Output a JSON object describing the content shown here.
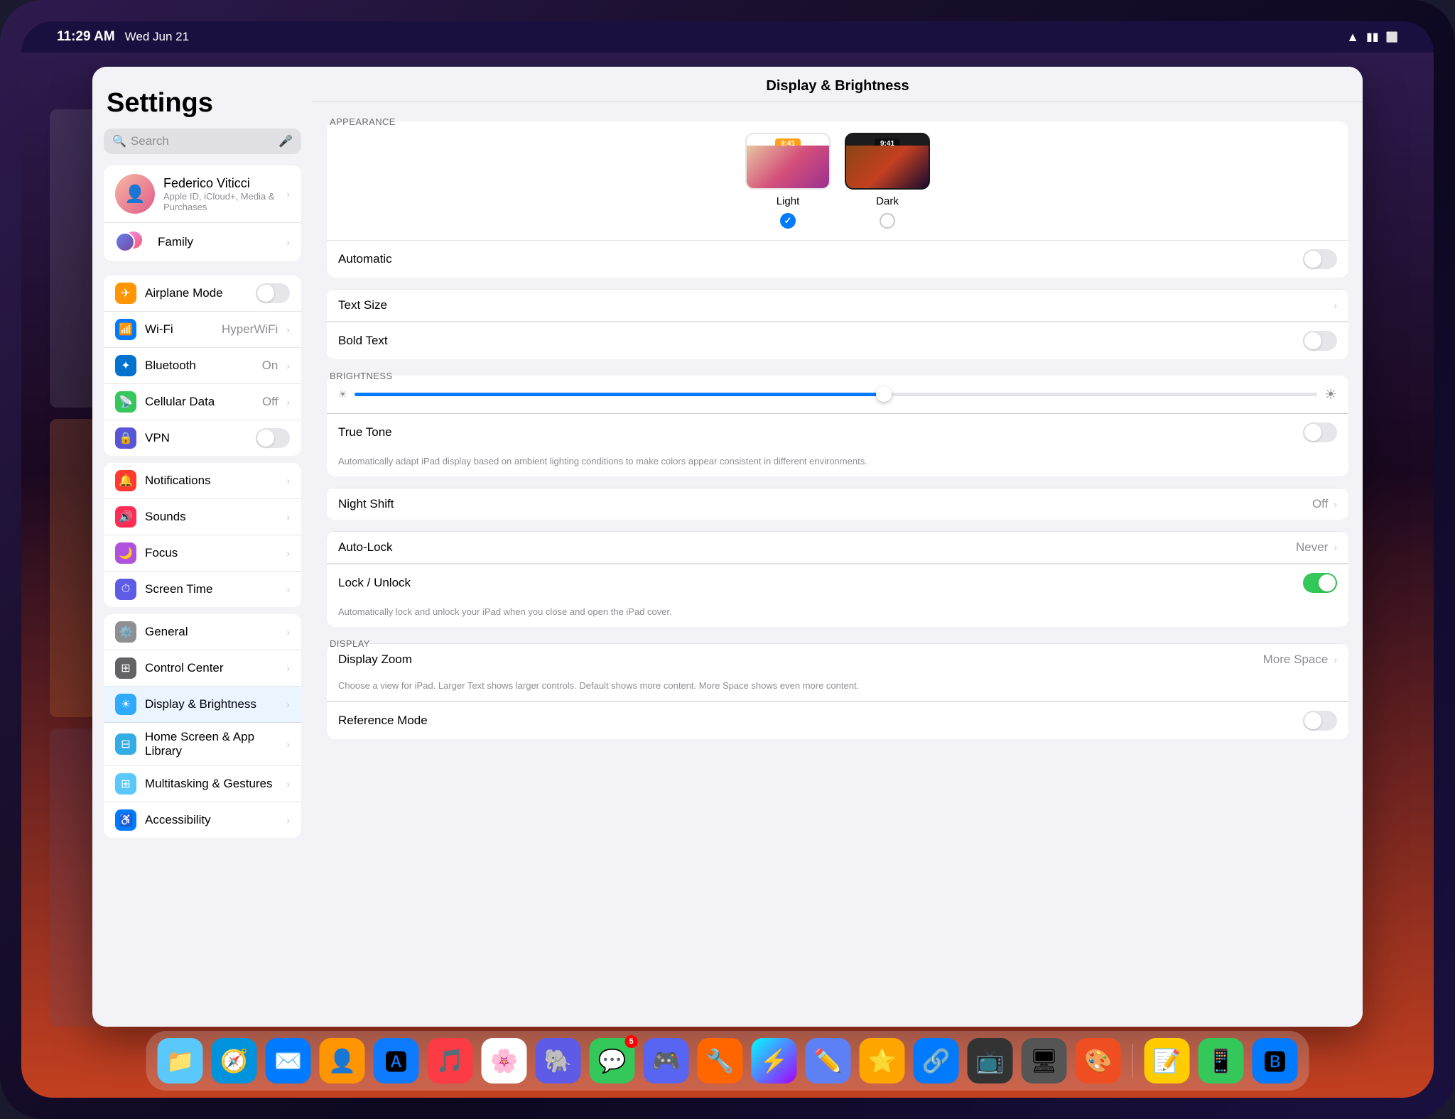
{
  "statusBar": {
    "time": "11:29 AM",
    "date": "Wed Jun 21",
    "battery": "🔋",
    "wifi": "wifi",
    "signals": "signal"
  },
  "sidebar": {
    "title": "Settings",
    "search": {
      "placeholder": "Search"
    },
    "account": {
      "name": "Federico Viticci",
      "subtitle": "Apple ID, iCloud+, Media & Purchases",
      "familyLabel": "Family"
    },
    "groups": [
      {
        "items": [
          {
            "icon": "airplane",
            "label": "Airplane Mode",
            "type": "toggle",
            "value": "off",
            "iconColor": "icon-orange"
          },
          {
            "icon": "wifi",
            "label": "Wi-Fi",
            "type": "value",
            "value": "HyperWiFi",
            "iconColor": "icon-blue"
          },
          {
            "icon": "bluetooth",
            "label": "Bluetooth",
            "type": "value",
            "value": "On",
            "iconColor": "icon-blue-dark"
          },
          {
            "icon": "cellular",
            "label": "Cellular Data",
            "type": "value",
            "value": "Off",
            "iconColor": "icon-green"
          },
          {
            "icon": "vpn",
            "label": "VPN",
            "type": "toggle",
            "value": "off",
            "iconColor": "icon-blue2"
          }
        ]
      },
      {
        "items": [
          {
            "icon": "notifications",
            "label": "Notifications",
            "type": "chevron",
            "iconColor": "icon-red"
          },
          {
            "icon": "sounds",
            "label": "Sounds",
            "type": "chevron",
            "iconColor": "icon-red2"
          },
          {
            "icon": "focus",
            "label": "Focus",
            "type": "chevron",
            "iconColor": "icon-purple"
          },
          {
            "icon": "screentime",
            "label": "Screen Time",
            "type": "chevron",
            "iconColor": "icon-purple2"
          }
        ]
      },
      {
        "items": [
          {
            "icon": "general",
            "label": "General",
            "type": "chevron",
            "iconColor": "icon-gray"
          },
          {
            "icon": "controlcenter",
            "label": "Control Center",
            "type": "chevron",
            "iconColor": "icon-gray2"
          },
          {
            "icon": "display",
            "label": "Display & Brightness",
            "type": "chevron",
            "iconColor": "icon-blue3",
            "active": true
          },
          {
            "icon": "homescreen",
            "label": "Home Screen & App Library",
            "type": "chevron",
            "iconColor": "icon-blue4"
          },
          {
            "icon": "multitasking",
            "label": "Multitasking & Gestures",
            "type": "chevron",
            "iconColor": "icon-teal"
          },
          {
            "icon": "accessibility",
            "label": "Accessibility",
            "type": "chevron",
            "iconColor": "icon-blue"
          }
        ]
      }
    ]
  },
  "rightPanel": {
    "title": "Display & Brightness",
    "sections": {
      "appearance": {
        "sectionLabel": "APPEARANCE",
        "options": [
          {
            "name": "Light",
            "selected": true
          },
          {
            "name": "Dark",
            "selected": false
          }
        ],
        "automaticLabel": "Automatic",
        "automaticToggle": "off"
      },
      "textSize": {
        "label": "Text Size"
      },
      "boldText": {
        "label": "Bold Text",
        "toggle": "off"
      },
      "brightness": {
        "sectionLabel": "BRIGHTNESS",
        "sliderValue": 55,
        "trueToneLabel": "True Tone",
        "trueToneToggle": "off",
        "trueToneDescription": "Automatically adapt iPad display based on ambient lighting conditions to make colors appear consistent in different environments.",
        "nightShiftLabel": "Night Shift",
        "nightShiftValue": "Off"
      },
      "autoLock": {
        "label": "Auto-Lock",
        "value": "Never"
      },
      "lockUnlock": {
        "label": "Lock / Unlock",
        "toggle": "on",
        "description": "Automatically lock and unlock your iPad when you close and open the iPad cover."
      },
      "display": {
        "sectionLabel": "DISPLAY",
        "displayZoomLabel": "Display Zoom",
        "displayZoomValue": "More Space",
        "displayZoomDesc": "Choose a view for iPad. Larger Text shows larger controls. Default shows more content. More Space shows even more content.",
        "referenceModeLabel": "Reference Mode",
        "referenceModeToggle": "off"
      }
    }
  },
  "dock": {
    "apps": [
      {
        "name": "Files",
        "color": "#5ac8fa",
        "emoji": "📁"
      },
      {
        "name": "Safari",
        "color": "#0093dd",
        "emoji": "🧭"
      },
      {
        "name": "Mail",
        "color": "#007aff",
        "emoji": "✉️"
      },
      {
        "name": "Contacts",
        "color": "#ff9500",
        "emoji": "👤"
      },
      {
        "name": "App Store",
        "color": "#007aff",
        "emoji": "🅰"
      },
      {
        "name": "Music",
        "color": "#ff2d55",
        "emoji": "🎵"
      },
      {
        "name": "Photos",
        "color": "#fff",
        "emoji": "🌸"
      },
      {
        "name": "Sequel Pro",
        "color": "#5e5ce6",
        "emoji": "🐘"
      },
      {
        "name": "Messages",
        "color": "#34c759",
        "emoji": "💬",
        "badge": "5"
      },
      {
        "name": "Discord",
        "color": "#5865f2",
        "emoji": "🎮"
      },
      {
        "name": "Toolbox",
        "color": "#ff6b00",
        "emoji": "🔧"
      },
      {
        "name": "Shortcut",
        "color": "#aa44ff",
        "emoji": "⚡"
      },
      {
        "name": "Craft",
        "color": "#5e80f5",
        "emoji": "✏️"
      },
      {
        "name": "Superstar",
        "color": "#ffd700",
        "emoji": "⭐"
      },
      {
        "name": "Linked",
        "color": "#007aff",
        "emoji": "🔗"
      },
      {
        "name": "TV",
        "color": "#333",
        "emoji": "📺"
      },
      {
        "name": "TV2",
        "color": "#555",
        "emoji": "🖥"
      },
      {
        "name": "SketchUp",
        "color": "#ef4e23",
        "emoji": "🎨"
      },
      {
        "name": "Notes",
        "color": "#ffcc00",
        "emoji": "📝"
      },
      {
        "name": "Device",
        "color": "#34c759",
        "emoji": "📱"
      },
      {
        "name": "AppStore2",
        "color": "#007aff",
        "emoji": "🅱"
      }
    ]
  }
}
